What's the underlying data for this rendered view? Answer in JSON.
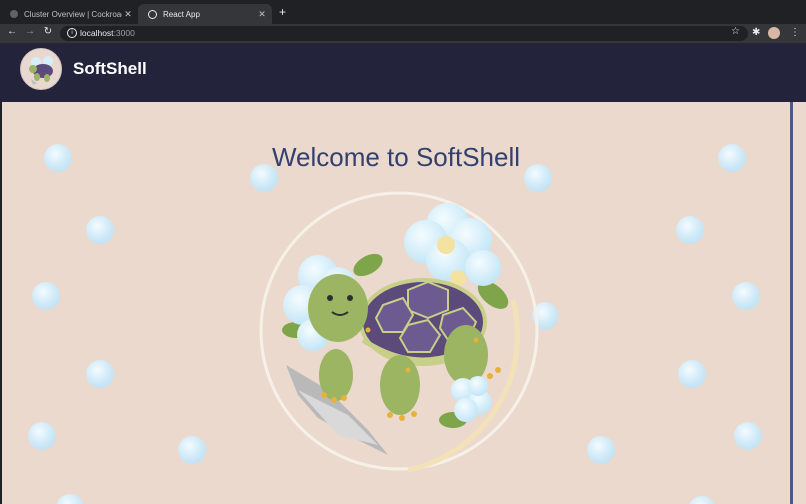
{
  "browser": {
    "tabs": [
      {
        "title": "Cluster Overview | Cockroach",
        "active": false
      },
      {
        "title": "React App",
        "active": true
      }
    ],
    "new_tab_icon": "plus-icon",
    "url": {
      "host": "localhost",
      "port": ":3000"
    }
  },
  "header": {
    "brand": "SoftShell",
    "logo_icon": "tortoise-logo-icon",
    "background": "#23233b"
  },
  "main": {
    "title": "Welcome to SoftShell",
    "hero_icon": "tortoise-with-flowers-icon",
    "background": "#ebd9ce",
    "title_color": "#33406e"
  }
}
